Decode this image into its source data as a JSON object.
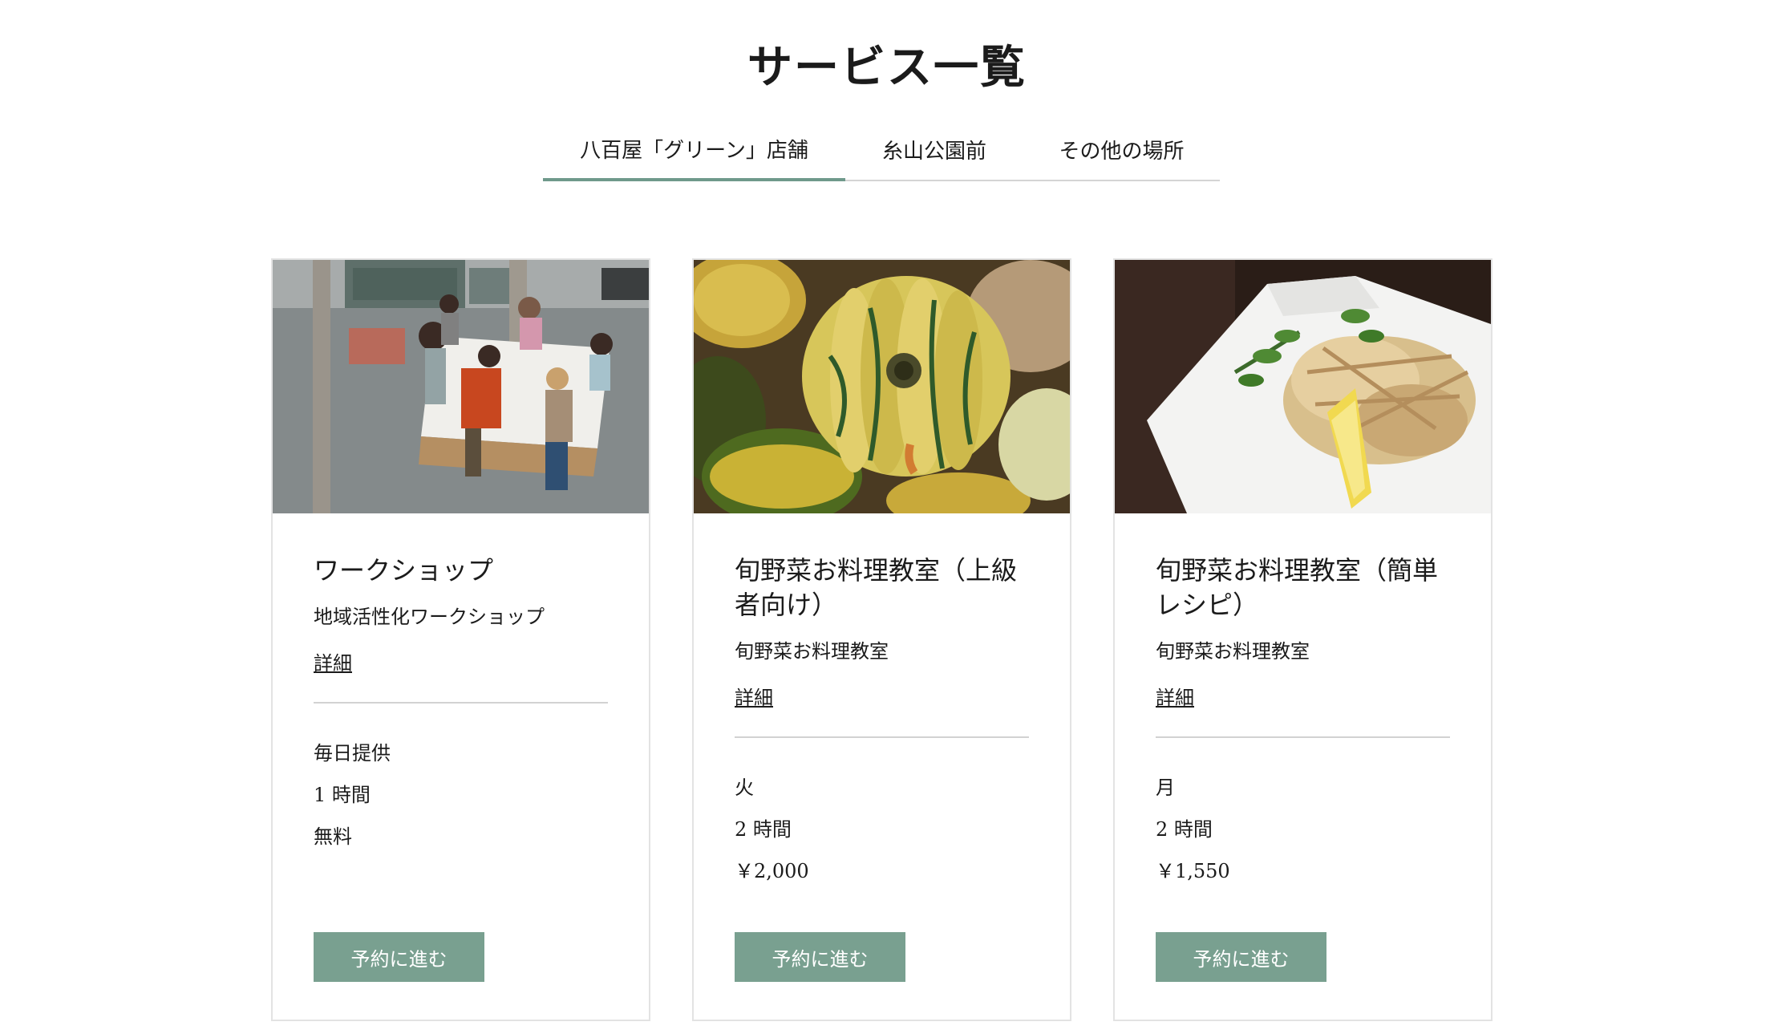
{
  "page": {
    "title": "サービス一覧"
  },
  "tabs": [
    {
      "label": "八百屋「グリーン」店舗",
      "active": true
    },
    {
      "label": "糸山公園前",
      "active": false
    },
    {
      "label": "その他の場所",
      "active": false
    }
  ],
  "colors": {
    "accent": "#6f998b",
    "button": "#79a090"
  },
  "cards": [
    {
      "image": "workshop-photo",
      "title": "ワークショップ",
      "subtitle": "地域活性化ワークショップ",
      "detail_label": "詳細",
      "schedule": "毎日提供",
      "duration": "1 時間",
      "price": "無料",
      "button_label": "予約に進む"
    },
    {
      "image": "squash-photo",
      "title": "旬野菜お料理教室（上級者向け）",
      "subtitle": "旬野菜お料理教室",
      "detail_label": "詳細",
      "schedule": "火",
      "duration": "2 時間",
      "price": "￥2,000",
      "button_label": "予約に進む"
    },
    {
      "image": "tempura-photo",
      "title": "旬野菜お料理教室（簡単レシピ）",
      "subtitle": "旬野菜お料理教室",
      "detail_label": "詳細",
      "schedule": "月",
      "duration": "2 時間",
      "price": "￥1,550",
      "button_label": "予約に進む"
    }
  ]
}
